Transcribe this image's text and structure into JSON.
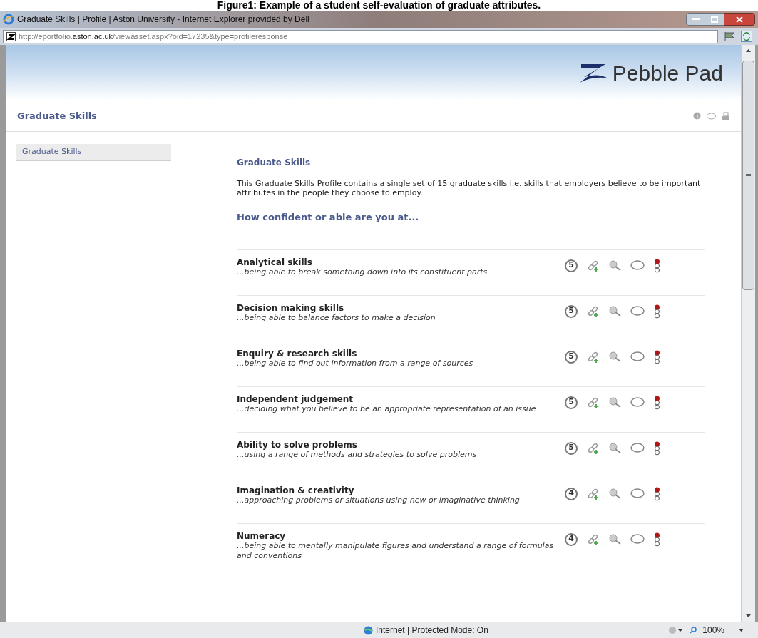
{
  "caption": "Figure1: Example of a student self-evaluation of graduate attributes.",
  "window": {
    "title": "Graduate Skills | Profile | Aston University - Internet Explorer provided by Dell"
  },
  "address_bar": {
    "url_start": "http://eportfolio.",
    "url_domain": "aston.ac.uk",
    "url_rest": "/viewasset.aspx?oid=17235&type=profileresponse"
  },
  "banner": {
    "logo_text": "Pebble Pad"
  },
  "page_header": {
    "title": "Graduate Skills"
  },
  "sidebar": {
    "items": [
      {
        "label": "Graduate Skills",
        "selected": true
      }
    ]
  },
  "content": {
    "title": "Graduate Skills",
    "intro": "This Graduate Skills Profile contains a single set of 15 graduate skills i.e. skills that employers believe to be important attributes in the people they choose to employ.",
    "question": "How confident or able are you at...",
    "skills": [
      {
        "name": "Analytical skills",
        "description": "...being able to break something down into its constituent parts",
        "rating": "5"
      },
      {
        "name": "Decision making skills",
        "description": "...being able to balance factors to make a decision",
        "rating": "5"
      },
      {
        "name": "Enquiry & research skills",
        "description": "...being able to find out information from a range of sources",
        "rating": "5"
      },
      {
        "name": "Independent judgement",
        "description": "...deciding what you believe to be an appropriate representation of an issue",
        "rating": "5"
      },
      {
        "name": "Ability to solve problems",
        "description": "...using a range of methods and strategies to solve problems",
        "rating": "5"
      },
      {
        "name": "Imagination & creativity",
        "description": "...approaching problems or situations using new or imaginative thinking",
        "rating": "4"
      },
      {
        "name": "Numeracy",
        "description": "...being able to mentally manipulate figures and understand a range of formulas and conventions",
        "rating": "4"
      }
    ]
  },
  "status_bar": {
    "zone": "Internet | Protected Mode: On",
    "zoom": "100%"
  }
}
